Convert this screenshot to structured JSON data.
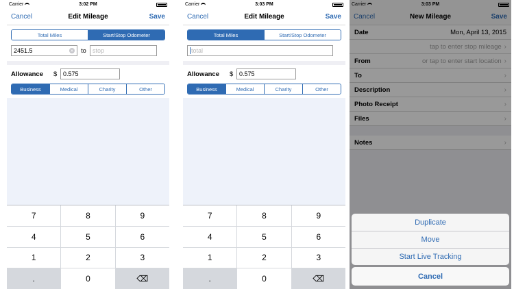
{
  "screen1": {
    "status": {
      "carrier": "Carrier",
      "time": "3:02 PM"
    },
    "nav": {
      "left": "Cancel",
      "title": "Edit Mileage",
      "right": "Save"
    },
    "mode_tabs": [
      "Total Miles",
      "Start/Stop Odometer"
    ],
    "start_value": "2451.5",
    "to_label": "to",
    "stop_placeholder": "stop",
    "allowance_label": "Allowance",
    "currency": "$",
    "allowance_value": "0.575",
    "categories": [
      "Business",
      "Medical",
      "Charity",
      "Other"
    ]
  },
  "screen2": {
    "status": {
      "carrier": "Carrier",
      "time": "3:03 PM"
    },
    "nav": {
      "left": "Cancel",
      "title": "Edit Mileage",
      "right": "Save"
    },
    "mode_tabs": [
      "Total Miles",
      "Start/Stop Odometer"
    ],
    "total_placeholder": "total",
    "allowance_label": "Allowance",
    "currency": "$",
    "allowance_value": "0.575",
    "categories": [
      "Business",
      "Medical",
      "Charity",
      "Other"
    ]
  },
  "keypad": [
    "7",
    "8",
    "9",
    "4",
    "5",
    "6",
    "1",
    "2",
    "3",
    ".",
    "0",
    "⌫"
  ],
  "screen3": {
    "status": {
      "carrier": "Carrier",
      "time": "3:03 PM"
    },
    "nav": {
      "left": "Cancel",
      "title": "New Mileage",
      "right": "Save"
    },
    "date_label": "Date",
    "date_value": "Mon,  April 13, 2015",
    "stop_hint": "tap to enter stop mileage",
    "from_label": "From",
    "from_hint": "or tap to enter start location",
    "to_label": "To",
    "description_label": "Description",
    "photo_label": "Photo Receipt",
    "files_label": "Files",
    "notes_label": "Notes",
    "actions": [
      "Duplicate",
      "Move",
      "Start Live Tracking"
    ],
    "cancel_label": "Cancel"
  },
  "colors": {
    "accent": "#2f6bb3",
    "background_gray": "#efeff4",
    "field_area": "#eef2fa"
  }
}
